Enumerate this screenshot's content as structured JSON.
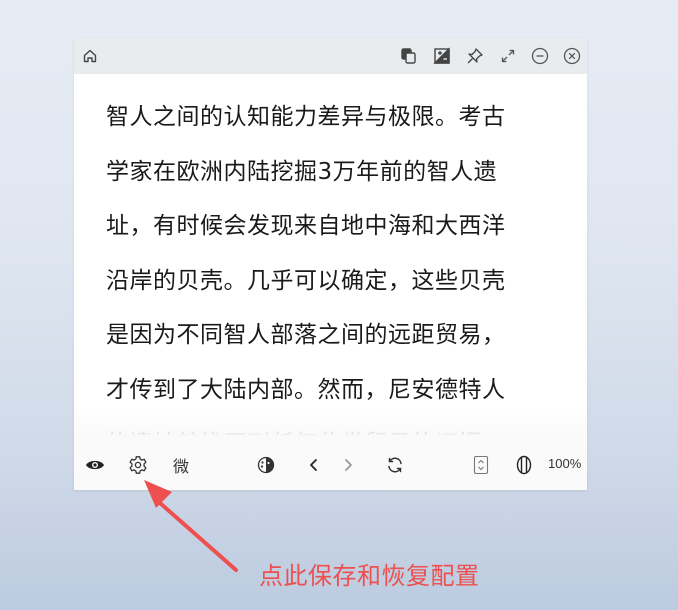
{
  "reader": {
    "text_lines": [
      "智人之间的认知能力差异与极限。考古",
      "学家在欧洲内陆挖掘3万年前的智人遗",
      "址，有时候会发现来自地中海和大西洋",
      "沿岸的贝壳。几乎可以确定，这些贝壳",
      "是因为不同智人部落之间的远距贸易，",
      "才传到了大陆内部。然而，尼安德特人",
      "的遗址就找不到任何此类贸易的证据，"
    ]
  },
  "titlebar": {
    "icons": [
      "home-icon",
      "copy-icon",
      "image-edit-icon",
      "pin-icon",
      "expand-icon",
      "minimize-icon",
      "close-icon"
    ]
  },
  "bottombar": {
    "wei_label": "微",
    "zoom": "100%",
    "icons": [
      "eye-icon",
      "settings-icon",
      "theme-icon",
      "prev-icon",
      "next-icon",
      "refresh-icon",
      "scroll-mode-icon",
      "page-mode-icon"
    ]
  },
  "annotation": {
    "text": "点此保存和恢复配置",
    "color": "#ee4f4f"
  },
  "colors": {
    "titlebar_bg": "#e9ecef",
    "text": "#1a1a1a",
    "accent_red": "#ee4f4f"
  }
}
